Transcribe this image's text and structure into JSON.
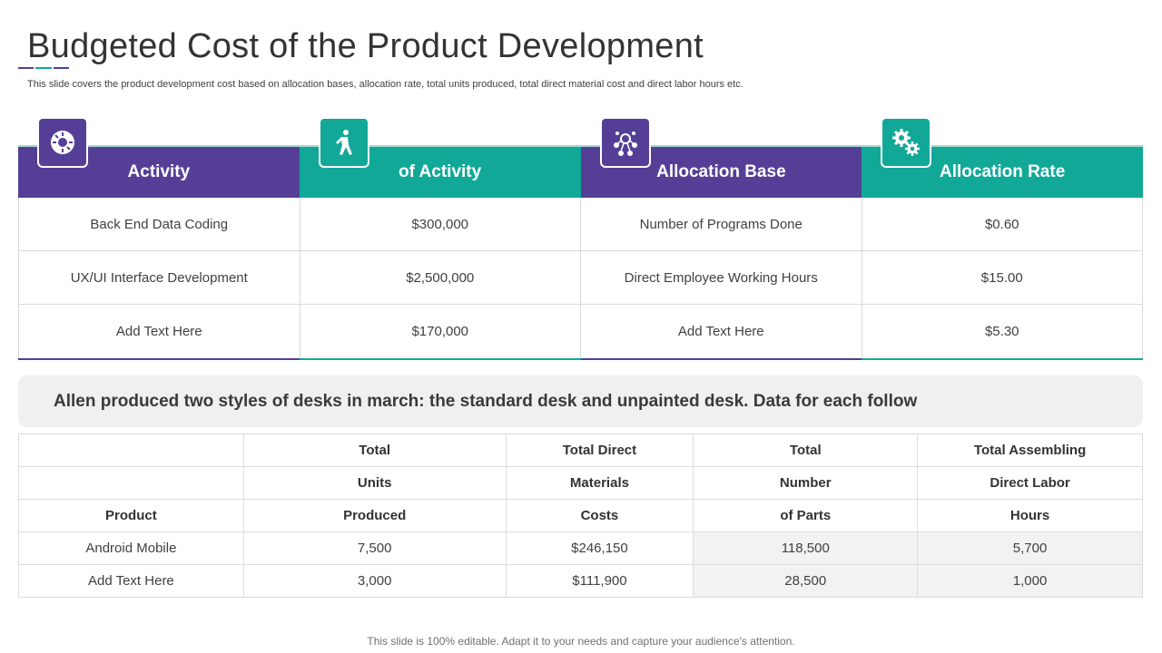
{
  "slide": {
    "title": "Budgeted Cost of the Product Development",
    "subtitle": "This slide covers the product development cost based on allocation bases, allocation rate, total units produced, total direct material cost and direct labor hours  etc.",
    "footer": "This slide is 100% editable. Adapt it to your needs and capture your audience's attention."
  },
  "colors": {
    "purple": "#553f96",
    "teal": "#12a898",
    "accent_line": [
      "#553f96",
      "#12a898",
      "#553f96"
    ]
  },
  "top_table": {
    "headers": [
      {
        "label": "Activity",
        "icon": "settings-gear-icon",
        "color": "purple"
      },
      {
        "label": "of Activity",
        "icon": "running-person-icon",
        "color": "teal"
      },
      {
        "label": "Allocation Base",
        "icon": "network-people-icon",
        "color": "purple"
      },
      {
        "label": "Allocation Rate",
        "icon": "gears-icon",
        "color": "teal"
      }
    ],
    "rows": [
      [
        "Back End Data Coding",
        "$300,000",
        "Number of Programs Done",
        "$0.60"
      ],
      [
        "UX/UI Interface Development",
        "$2,500,000",
        "Direct Employee Working Hours",
        "$15.00"
      ],
      [
        "Add Text Here",
        "$170,000",
        "Add Text Here",
        "$5.30"
      ]
    ]
  },
  "banner": "Allen produced two styles of desks in march: the standard desk and unpainted desk. Data for each follow",
  "bottom_table": {
    "header_rows": [
      [
        "",
        "Total",
        "Total Direct",
        "Total",
        "Total Assembling"
      ],
      [
        "",
        "Units",
        "Materials",
        "Number",
        "Direct Labor"
      ],
      [
        "Product",
        "Produced",
        "Costs",
        "of Parts",
        "Hours"
      ]
    ],
    "rows": [
      [
        "Android Mobile",
        "7,500",
        "$246,150",
        "118,500",
        "5,700"
      ],
      [
        "Add Text Here",
        "3,000",
        "$111,900",
        "28,500",
        "1,000"
      ]
    ]
  }
}
